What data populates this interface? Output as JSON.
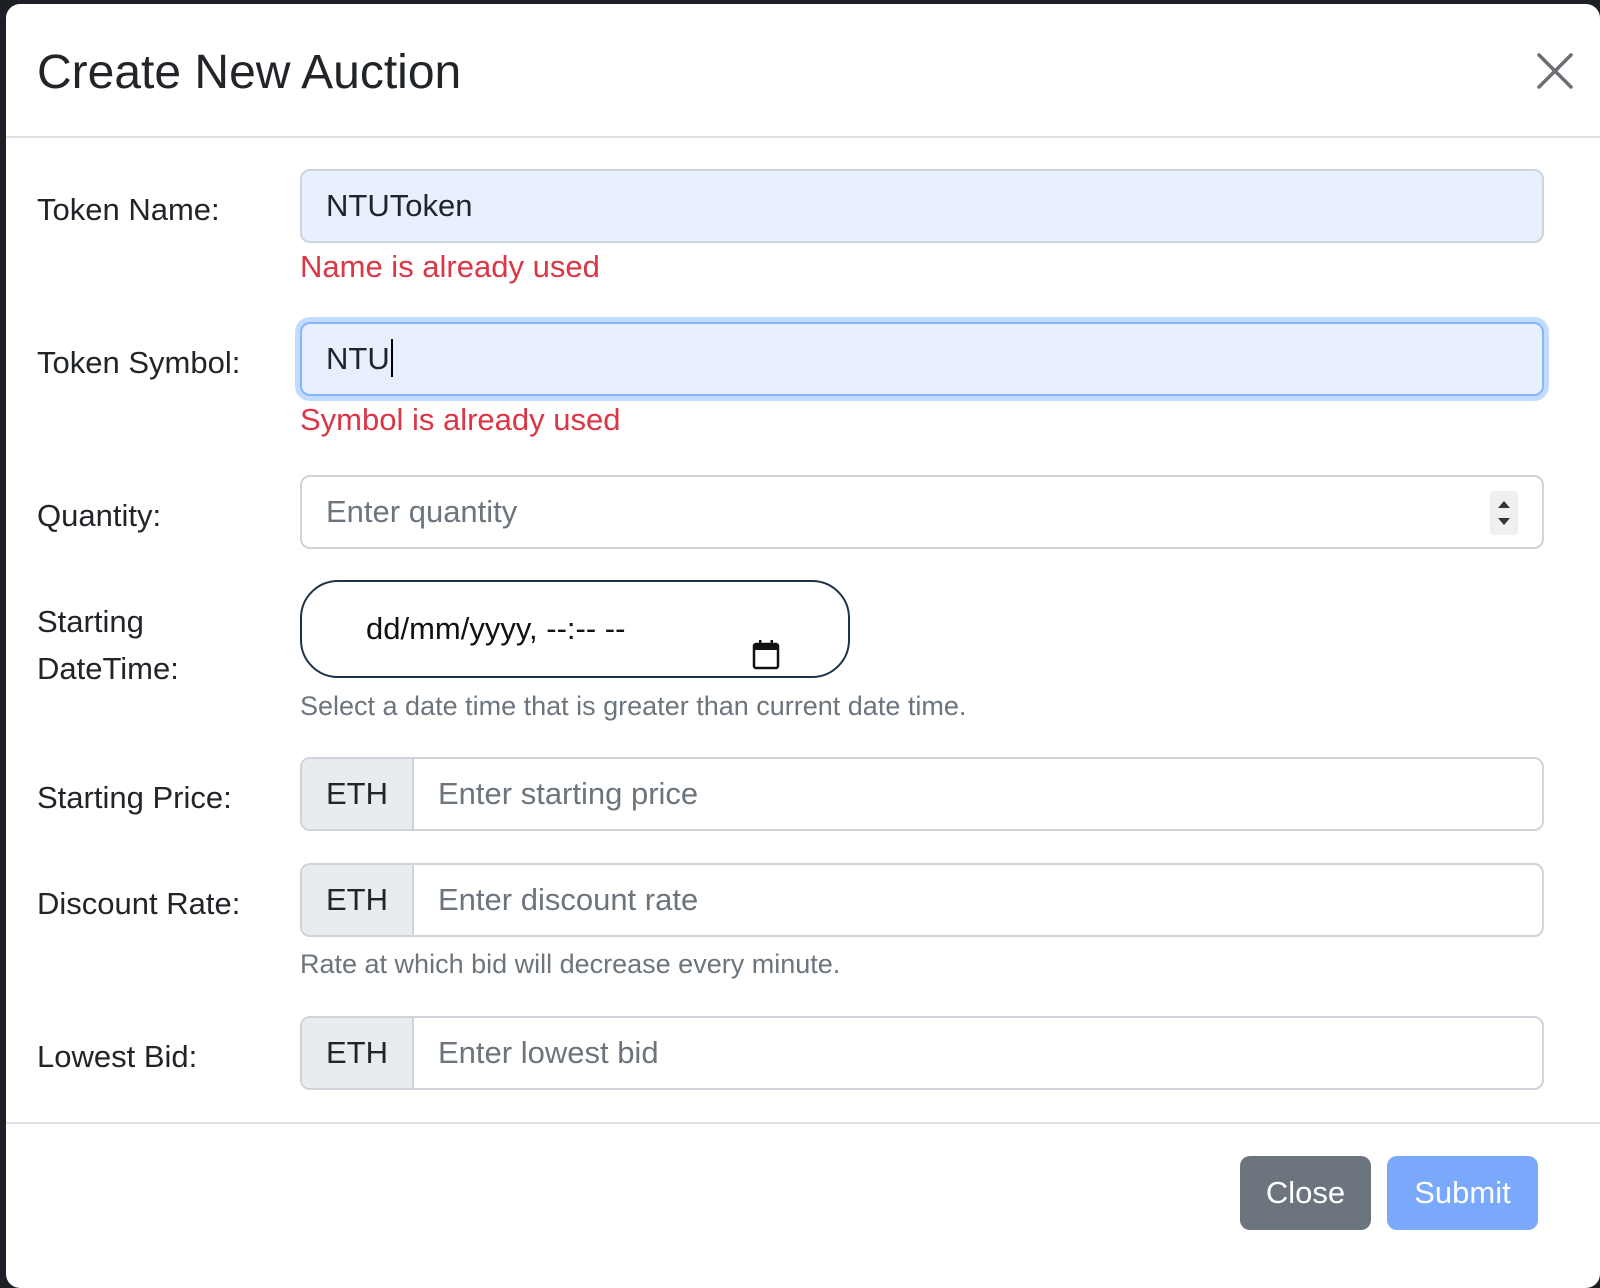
{
  "modal": {
    "title": "Create New Auction",
    "close_icon": "close-icon"
  },
  "form": {
    "token_name": {
      "label": "Token Name:",
      "value": "NTUToken",
      "error": "Name is already used"
    },
    "token_symbol": {
      "label": "Token Symbol:",
      "value": "NTU",
      "error": "Symbol is already used"
    },
    "quantity": {
      "label": "Quantity:",
      "placeholder": "Enter quantity"
    },
    "starting_datetime": {
      "label_line1": "Starting",
      "label_line2": "DateTime:",
      "value": "dd/mm/yyyy, --:-- --",
      "help": "Select a date time that is greater than current date time."
    },
    "starting_price": {
      "label": "Starting Price:",
      "addon": "ETH",
      "placeholder": "Enter starting price"
    },
    "discount_rate": {
      "label": "Discount Rate:",
      "addon": "ETH",
      "placeholder": "Enter discount rate",
      "help": "Rate at which bid will decrease every minute."
    },
    "lowest_bid": {
      "label": "Lowest Bid:",
      "addon": "ETH",
      "placeholder": "Enter lowest bid"
    }
  },
  "footer": {
    "close_label": "Close",
    "submit_label": "Submit"
  },
  "colors": {
    "error": "#dc3545",
    "help": "#6c757d",
    "close_button": "#6c757d",
    "submit_button": "#7aa8fb",
    "autofill_bg": "#e8f0fe"
  }
}
